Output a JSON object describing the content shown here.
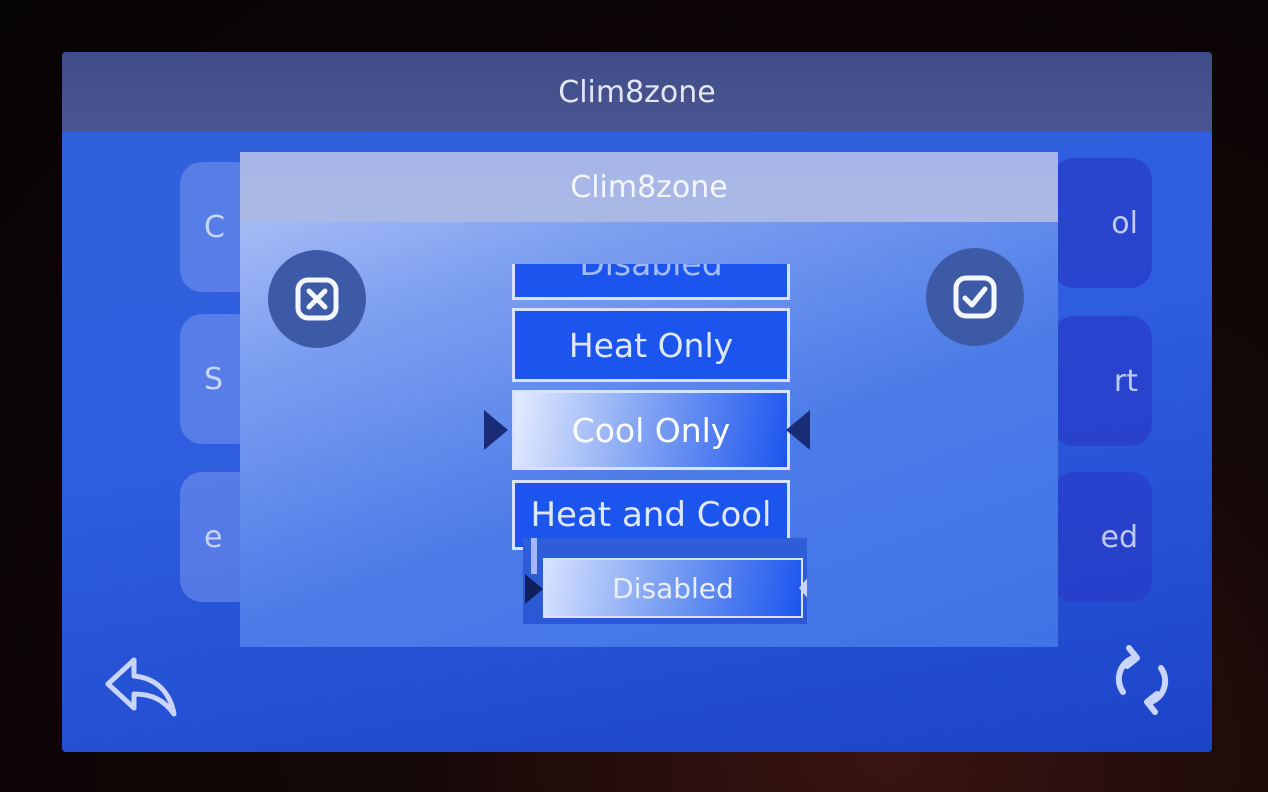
{
  "screen": {
    "title": "Clim8zone",
    "left_tiles": [
      {
        "label": "C"
      },
      {
        "label": "S"
      },
      {
        "label": "e"
      }
    ],
    "right_tiles": [
      {
        "label": "ol"
      },
      {
        "label": "rt"
      },
      {
        "label": "ed"
      }
    ],
    "back_icon": "back-arrow-icon",
    "refresh_icon": "refresh-icon"
  },
  "dialog": {
    "title": "Clim8zone",
    "cancel_icon": "cancel-x-icon",
    "confirm_icon": "checkmark-icon",
    "picker": {
      "items": [
        "Disabled",
        "Heat Only",
        "Cool Only",
        "Heat and Cool"
      ],
      "selected": "Cool Only"
    }
  },
  "inset": {
    "label": "Disabled"
  },
  "colors": {
    "screen_blue": "#2f5fe0",
    "header": "#4a5690",
    "dialog_header": "#a9b8e4",
    "picker_item": "#1b55ee",
    "button_circle": "#3d5aa6",
    "arrow": "#1a2b77"
  }
}
